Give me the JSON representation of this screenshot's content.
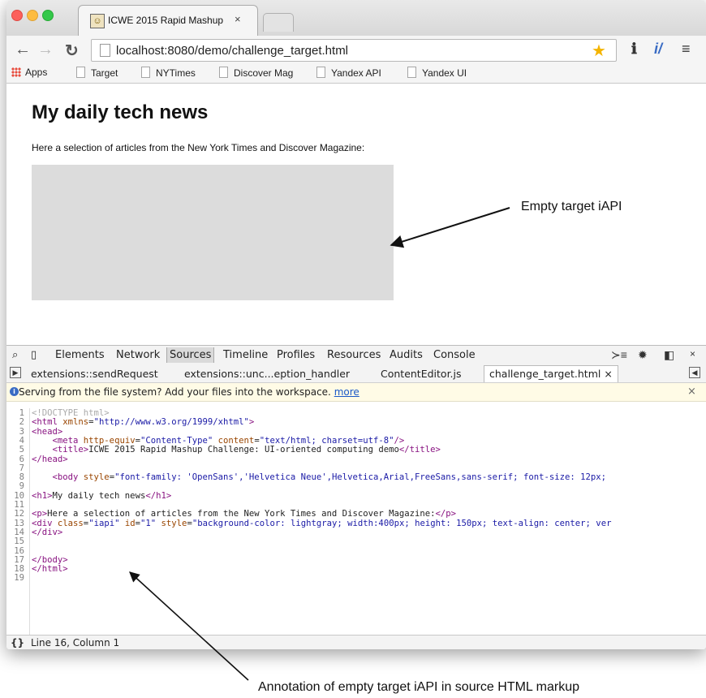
{
  "browser": {
    "tab_title": "ICWE 2015 Rapid Mashup",
    "tab_close": "×",
    "url": "localhost:8080/demo/challenge_target.html",
    "bookmarks": [
      "Apps",
      "Target",
      "NYTimes",
      "Discover Mag",
      "Yandex API",
      "Yandex UI"
    ]
  },
  "page": {
    "heading": "My daily tech news",
    "intro": "Here a selection of articles from the New York Times and Discover Magazine:"
  },
  "devtools": {
    "tabs": [
      "Elements",
      "Network",
      "Sources",
      "Timeline",
      "Profiles",
      "Resources",
      "Audits",
      "Console"
    ],
    "active_tab": "Sources",
    "file_tabs": [
      "extensions::sendRequest",
      "extensions::unc...eption_handler",
      "ContentEditor.js",
      "challenge_target.html ×"
    ],
    "active_file": "challenge_target.html ×",
    "info_message": "Serving from the file system? Add your files into the workspace.",
    "info_link": "more",
    "info_close": "×",
    "status_braces": "{}",
    "status": "Line 16, Column 1",
    "line_numbers": [
      "1",
      "2",
      "3",
      "4",
      "5",
      "6",
      "7",
      "8",
      "9",
      "10",
      "11",
      "12",
      "13",
      "14",
      "15",
      "16",
      "17",
      "18",
      "19"
    ]
  },
  "annotations": {
    "top": "Empty target iAPI",
    "bottom": "Annotation of empty target iAPI in source HTML markup"
  },
  "colors": {
    "tag": "#881280",
    "attr": "#994500",
    "value": "#1a1aa6",
    "box": "#dcdcdc"
  }
}
